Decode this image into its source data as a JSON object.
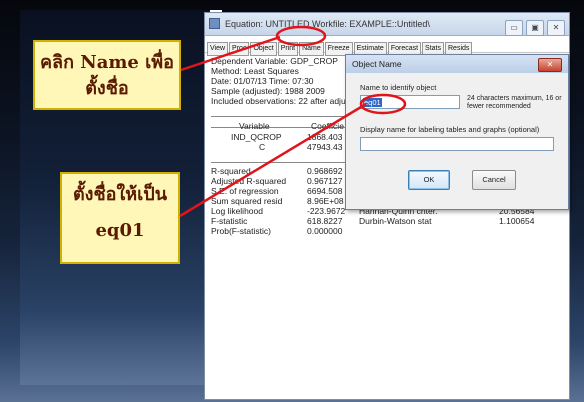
{
  "callouts": {
    "top": {
      "line1": "คลิก Name เพื่อ",
      "line2": "ตั้งชื่อ"
    },
    "bottom": {
      "line1": "ตั้งชื่อให้เป็น",
      "line2": "eq01"
    }
  },
  "window": {
    "title": "Equation: UNTITLED   Workfile: EXAMPLE::Untitled\\",
    "title_buttons": [
      "▭",
      "▣",
      "✕"
    ],
    "toolbar": [
      "View",
      "Proc",
      "Object",
      "Print",
      "Name",
      "Freeze",
      "Estimate",
      "Forecast",
      "Stats",
      "Resids"
    ]
  },
  "output": {
    "dep_var": "Dependent Variable: GDP_CROP",
    "method": "Method: Least Squares",
    "date": "Date: 01/07/13   Time: 07:30",
    "sample": "Sample (adjusted): 1988 2009",
    "obs": "Included observations: 22 after adjus",
    "headers": {
      "variable": "Variable",
      "coef": "Coefficie"
    },
    "rows": [
      {
        "var": "IND_QCROP",
        "coef": "1868.403"
      },
      {
        "var": "C",
        "coef": "47943.43"
      }
    ],
    "stats": [
      {
        "label": "R-squared",
        "value": "0.968692",
        "label2": "",
        "value2": ""
      },
      {
        "label": "Adjusted R-squared",
        "value": "0.967127",
        "label2": "",
        "value2": ""
      },
      {
        "label": "S.E. of regression",
        "value": "6694.508",
        "label2": "",
        "value2": ""
      },
      {
        "label": "Sum squared resid",
        "value": "8.96E+08",
        "label2": "",
        "value2": ""
      },
      {
        "label": "Log likelihood",
        "value": "-223.9672",
        "label2": "Hannan-Quinn criter.",
        "value2": "20.56584"
      },
      {
        "label": "F-statistic",
        "value": "618.8227",
        "label2": "Durbin-Watson stat",
        "value2": "1.100654"
      },
      {
        "label": "Prob(F-statistic)",
        "value": "0.000000",
        "label2": "",
        "value2": ""
      }
    ]
  },
  "dialog": {
    "title": "Object Name",
    "close": "✕",
    "name_label": "Name to identify object",
    "name_value": "eq01",
    "name_hint": "24 characters maximum, 16 or fewer recommended",
    "display_label": "Display name for labeling tables and graphs  (optional)",
    "display_value": "",
    "ok": "OK",
    "cancel": "Cancel"
  },
  "colors": {
    "accent_red": "#e0141a",
    "callout_bg": "#fff7b8"
  }
}
